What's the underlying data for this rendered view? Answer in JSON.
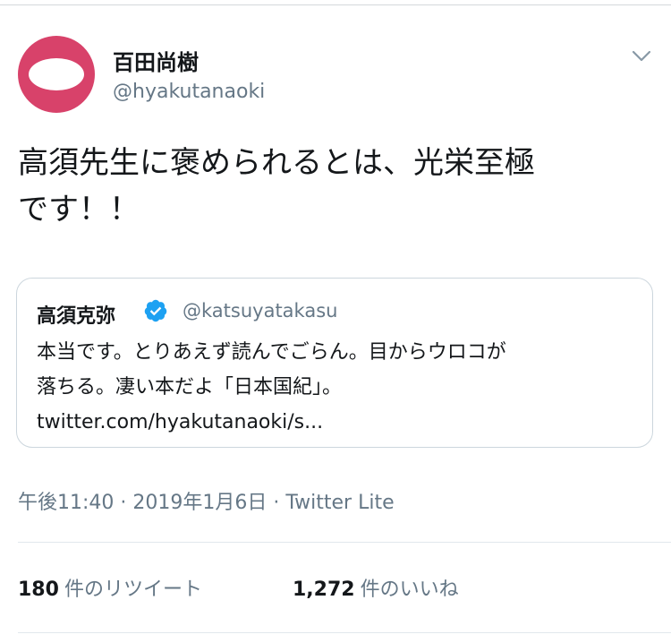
{
  "tweet": {
    "author": {
      "display_name": "百田尚樹",
      "handle": "@hyakutanaoki",
      "avatar_color": "#d8426a"
    },
    "menu_icon": "chevron-down-icon",
    "text_lines": [
      "高須先生に褒められるとは、光栄至極",
      "です！！"
    ],
    "quoted": {
      "display_name": "高須克弥",
      "verified_icon": "verified-badge-icon",
      "verified_color": "#1da1f2",
      "handle": "@katsuyatakasu",
      "text_lines": [
        "本当です。とりあえず読んでごらん。目からウロコが",
        "落ちる。凄い本だよ「日本国紀」。",
        "twitter.com/hyakutanaoki/s..."
      ]
    },
    "meta": "午後11:40 · 2019年1月6日 · Twitter Lite",
    "stats": {
      "retweets_count": "180",
      "retweets_label": "件のリツイート",
      "likes_count": "1,272",
      "likes_label": "件のいいね"
    }
  }
}
